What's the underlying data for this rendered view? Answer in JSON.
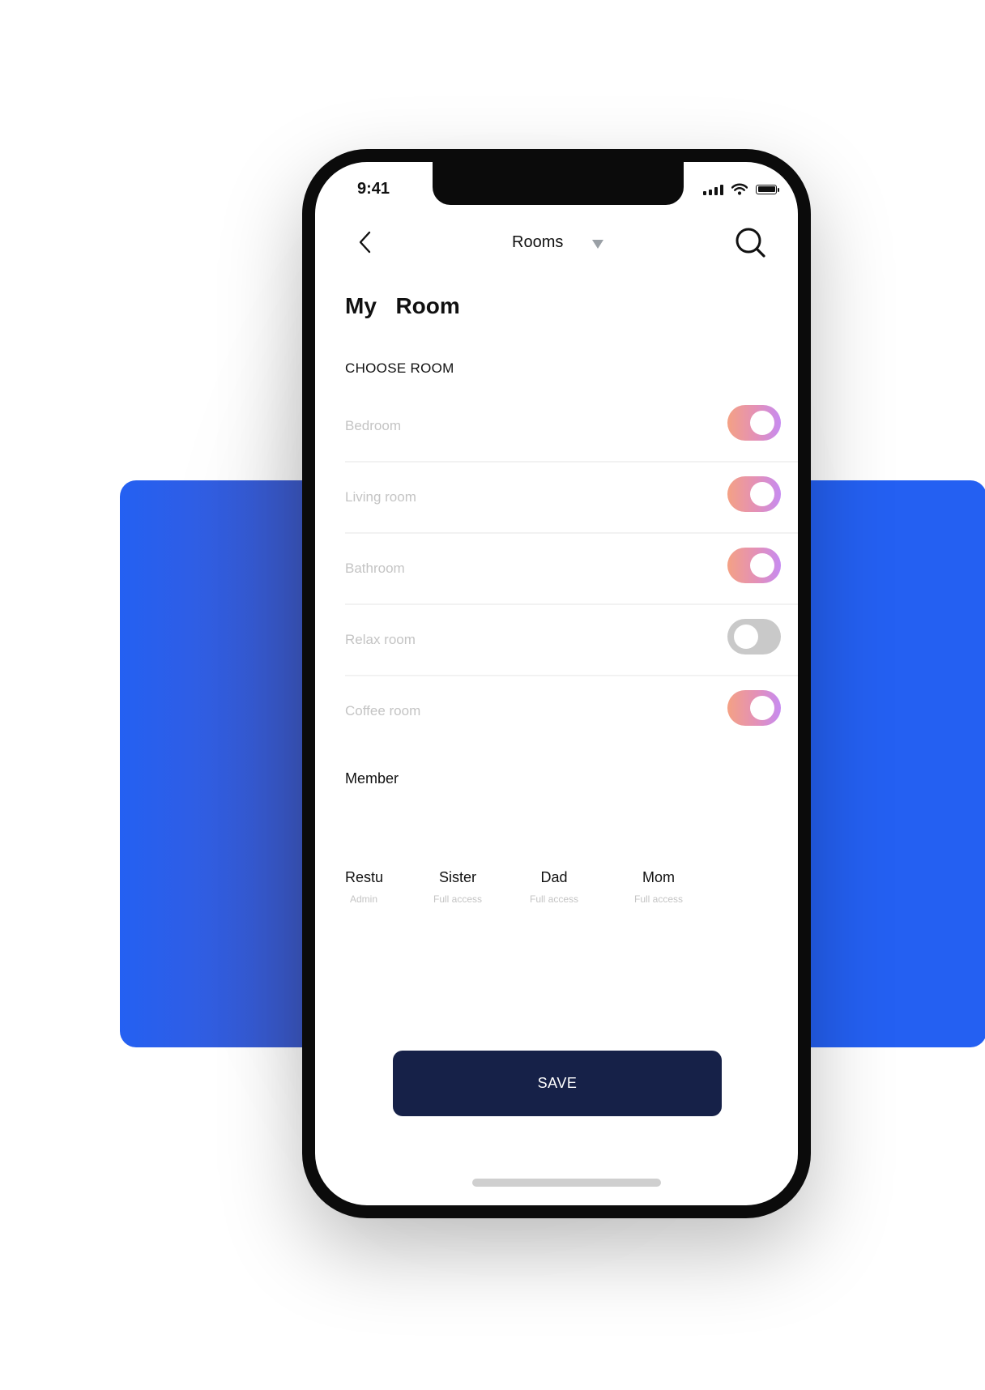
{
  "status_bar": {
    "time": "9:41",
    "icons": [
      "cellular-signal-icon",
      "wifi-icon",
      "battery-icon"
    ]
  },
  "nav": {
    "back_icon": "chevron-left-icon",
    "title": "Rooms",
    "dropdown_icon": "caret-down-icon",
    "search_icon": "search-icon"
  },
  "page": {
    "title": "My  Room",
    "choose_room_label": "CHOOSE ROOM"
  },
  "rooms": [
    {
      "name": "Bedroom",
      "enabled": true
    },
    {
      "name": "Living room",
      "enabled": true
    },
    {
      "name": "Bathroom",
      "enabled": true
    },
    {
      "name": "Relax room",
      "enabled": false
    },
    {
      "name": "Coffee room",
      "enabled": true
    }
  ],
  "members_section": {
    "label": "Member",
    "members": [
      {
        "name": "Restu",
        "role": "Admin"
      },
      {
        "name": "Sister",
        "role": "Full access"
      },
      {
        "name": "Dad",
        "role": "Full access"
      },
      {
        "name": "Mom",
        "role": "Full access"
      }
    ]
  },
  "actions": {
    "save_label": "SAVE"
  },
  "colors": {
    "accent_blue": "#2460f2",
    "save_button": "#162148",
    "toggle_on_start": "#f4a184",
    "toggle_on_end": "#c68bf2",
    "toggle_off": "#c9c9c9",
    "muted_text": "#c4c4c4"
  }
}
